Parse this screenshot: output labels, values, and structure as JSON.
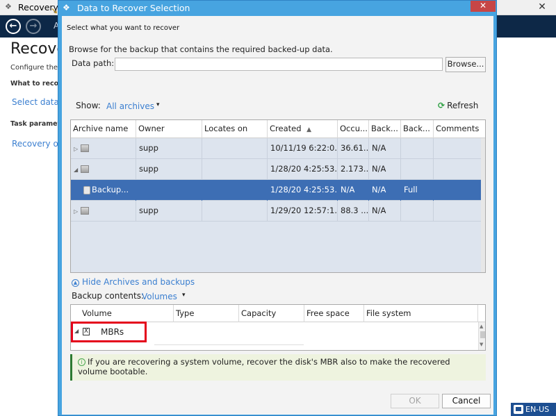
{
  "background_window": {
    "title": "Recovery",
    "close_label": "✕",
    "nav_letter": "A",
    "heading": "Recove",
    "configure_text": "Configure the re",
    "what_to_recover": "What to recover",
    "select_data_link": "Select data...",
    "task_parameters": "Task parameters",
    "recovery_options_link": "Recovery op",
    "language": "EN-US"
  },
  "dialog": {
    "title": "Data to Recover Selection",
    "close_label": "✕",
    "section_title": "Select what you want to recover",
    "browse_hint": "Browse for the backup that contains the required backed-up data.",
    "data_path_label": "Data path:",
    "data_path_value": "",
    "browse_button": "Browse...",
    "show_label": "Show:",
    "show_value": "All archives",
    "refresh_label": "Refresh",
    "archive_table": {
      "columns": [
        "Archive name",
        "Owner",
        "Locates on",
        "Created",
        "Occu...",
        "Back...",
        "Back...",
        "Comments"
      ],
      "sort_indicator": "▲",
      "rows": [
        {
          "name": "",
          "owner": "supp",
          "locates_on": "",
          "created": "10/11/19 6:22:0...",
          "occupied": "36.61...",
          "backup1": "N/A",
          "backup2": "",
          "comments": ""
        },
        {
          "name": "",
          "owner": "supp",
          "locates_on": "",
          "created": "1/28/20 4:25:53...",
          "occupied": "2.173...",
          "backup1": "N/A",
          "backup2": "",
          "comments": ""
        },
        {
          "name": "Backup...",
          "owner": "",
          "locates_on": "",
          "created": "1/28/20 4:25:53...",
          "occupied": "N/A",
          "backup1": "N/A",
          "backup2": "Full",
          "comments": ""
        },
        {
          "name": "",
          "owner": "supp",
          "locates_on": "",
          "created": "1/29/20 12:57:1...",
          "occupied": "88.3 ...",
          "backup1": "N/A",
          "backup2": "",
          "comments": ""
        }
      ]
    },
    "hide_link": "Hide Archives and backups",
    "backup_contents_label": "Backup contents:",
    "backup_contents_value": "Volumes",
    "volume_table": {
      "columns": [
        "Volume",
        "Type",
        "Capacity",
        "Free space",
        "File system"
      ],
      "row_label": "MBRs",
      "row_checkbox": "X"
    },
    "info_text": "If you are recovering a system volume, recover the disk's MBR also to make the recovered volume bootable.",
    "ok_button": "OK",
    "cancel_button": "Cancel"
  }
}
